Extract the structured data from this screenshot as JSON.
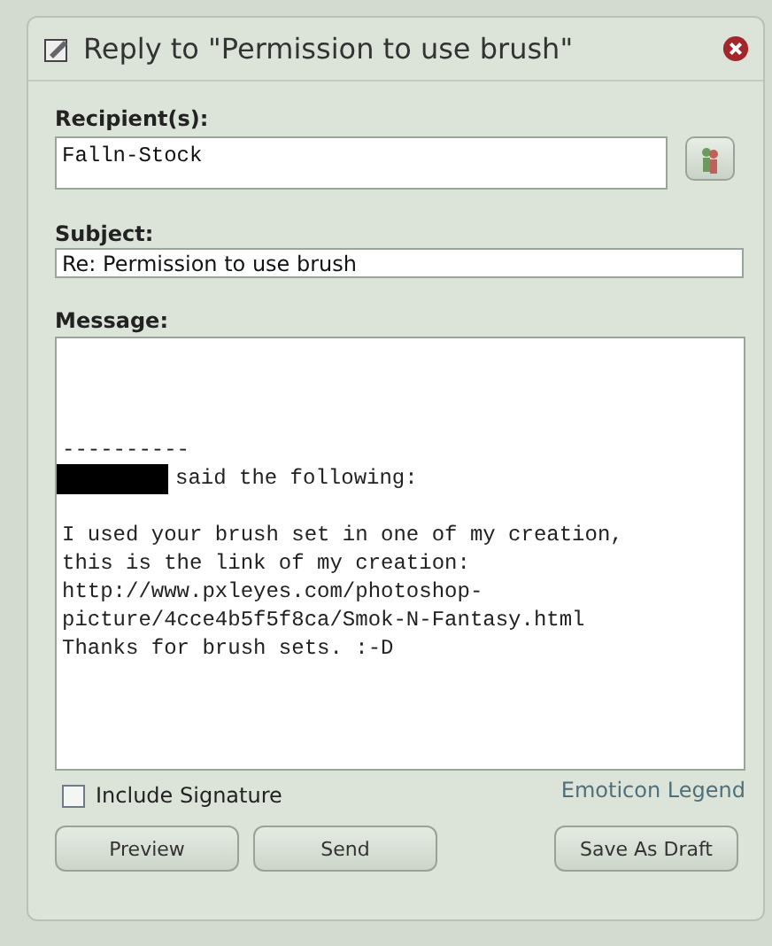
{
  "dialog": {
    "title": "Reply to \"Permission to use brush\""
  },
  "recipient": {
    "label": "Recipient(s):",
    "value": "Falln-Stock"
  },
  "subject": {
    "label": "Subject:",
    "value": "Re: Permission to use brush"
  },
  "message": {
    "label": "Message:",
    "lines": [
      {
        "kind": "blank"
      },
      {
        "kind": "blank"
      },
      {
        "kind": "blank"
      },
      {
        "kind": "text",
        "text": "----------"
      },
      {
        "kind": "redacted",
        "text": "said the following:"
      },
      {
        "kind": "blank"
      },
      {
        "kind": "text",
        "text": "I used your brush set in one of my creation,"
      },
      {
        "kind": "text",
        "text": "this is the link of my creation:"
      },
      {
        "kind": "text",
        "text": "http://www.pxleyes.com/photoshop-"
      },
      {
        "kind": "text",
        "text": "picture/4cce4b5f5f8ca/Smok-N-Fantasy.html"
      },
      {
        "kind": "text",
        "text": "Thanks for brush sets. :-D"
      }
    ]
  },
  "signature": {
    "label": "Include Signature",
    "checked": false
  },
  "emoticon_link": "Emoticon Legend",
  "buttons": {
    "left": [
      "Preview",
      "Send"
    ],
    "right": "Save As Draft"
  }
}
